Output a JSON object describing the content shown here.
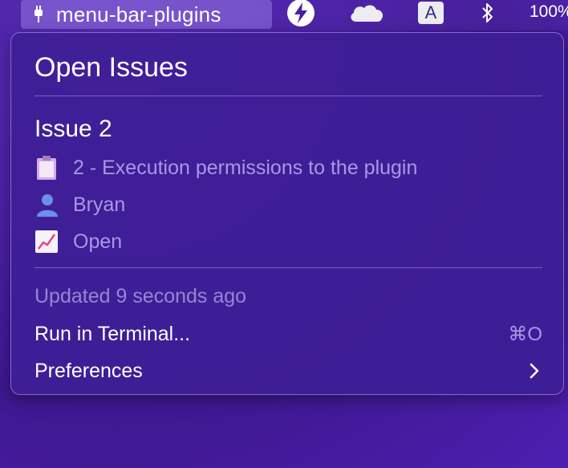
{
  "menubar": {
    "app_title": "menu-bar-plugins",
    "input_source": "A",
    "battery_text": "100%",
    "icons": [
      "plug-icon",
      "lightning-icon",
      "cloud-icon",
      "input-source-icon",
      "bluetooth-icon"
    ]
  },
  "dropdown": {
    "heading": "Open Issues",
    "issue_title": "Issue 2",
    "details": [
      {
        "icon": "clipboard-icon",
        "text": "2 - Execution permissions to the plugin"
      },
      {
        "icon": "person-icon",
        "text": "Bryan"
      },
      {
        "icon": "chart-up-icon",
        "text": "Open"
      }
    ],
    "updated": "Updated 9 seconds ago",
    "run_label": "Run in Terminal...",
    "run_shortcut": "⌘O",
    "preferences_label": "Preferences"
  },
  "colors": {
    "background": "#4a1fa3",
    "panel": "#3e1e96",
    "muted_text": "#a898e6",
    "separator": "#aa96e6"
  }
}
